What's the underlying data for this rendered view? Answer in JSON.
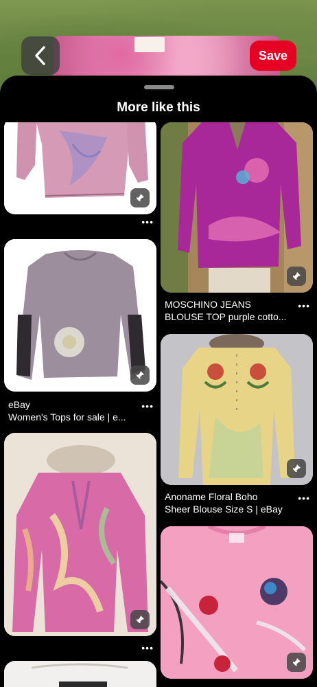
{
  "header": {
    "save_label": "Save",
    "back_icon": "chevron-left-icon"
  },
  "sheet": {
    "title": "More like this"
  },
  "colors": {
    "save": "#e60023",
    "background": "#000000",
    "text": "#ffffff"
  },
  "pins": {
    "left": [
      {
        "source": "",
        "title": "",
        "more": "•••"
      },
      {
        "source": "eBay",
        "title": "Women's Tops for sale | e...",
        "more": "•••"
      },
      {
        "source": "",
        "title": "",
        "more": "•••"
      }
    ],
    "right": [
      {
        "title_line1": "MOSCHINO JEANS",
        "title_line2": "BLOUSE TOP purple cotto...",
        "more": "•••"
      },
      {
        "title_line1": "Anoname Floral Boho",
        "title_line2": "Sheer Blouse Size S  | eBay",
        "more": "•••"
      },
      {
        "title_line1": "",
        "title_line2": "",
        "more": ""
      }
    ]
  }
}
